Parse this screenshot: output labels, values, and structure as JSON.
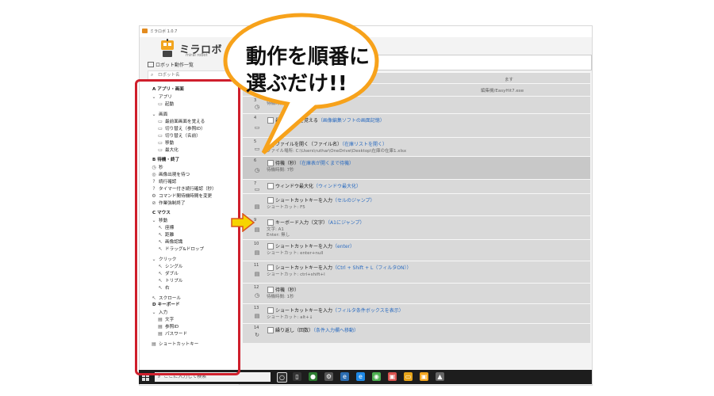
{
  "window": {
    "title": "ミラロボ 1.0.7"
  },
  "logo": {
    "brand": "ミラロボ",
    "subtitle": "mirai robot"
  },
  "toolbar": {
    "label": "ロボット動作一覧"
  },
  "search": {
    "placeholder": "ロボット名"
  },
  "sidebar": {
    "items": [
      {
        "text": "A  アプリ・画面",
        "indent": 0,
        "icon": "",
        "icon_name": "expand-chevron-icon"
      },
      {
        "text": "アプリ",
        "indent": 1,
        "icon": "⌄",
        "icon_name": "expand-chevron-icon"
      },
      {
        "text": "起動",
        "indent": 2,
        "icon": "▭",
        "icon_name": "window-icon"
      },
      {
        "text": "画面",
        "indent": 1,
        "icon": "⌄",
        "icon_name": "expand-chevron-icon"
      },
      {
        "text": "最前面画面を覚える",
        "indent": 2,
        "icon": "▭",
        "icon_name": "window-icon"
      },
      {
        "text": "切り替え（参照ID）",
        "indent": 2,
        "icon": "▭",
        "icon_name": "window-icon"
      },
      {
        "text": "切り替え（名前）",
        "indent": 2,
        "icon": "▭",
        "icon_name": "window-icon"
      },
      {
        "text": "移動",
        "indent": 2,
        "icon": "▭",
        "icon_name": "window-icon"
      },
      {
        "text": "最大化",
        "indent": 2,
        "icon": "▭",
        "icon_name": "window-icon"
      },
      {
        "text": "B  待機・終了",
        "indent": 0,
        "icon": "",
        "icon_name": "expand-chevron-icon"
      },
      {
        "text": "秒",
        "indent": 1,
        "icon": "◷",
        "icon_name": "clock-icon"
      },
      {
        "text": "画像出現を待つ",
        "indent": 1,
        "icon": "◎",
        "icon_name": "image-wait-icon"
      },
      {
        "text": "続行確認",
        "indent": 1,
        "icon": "?",
        "icon_name": "question-icon"
      },
      {
        "text": "タイマー付き続行確認（秒）",
        "indent": 1,
        "icon": "?",
        "icon_name": "question-icon"
      },
      {
        "text": "コマンド間待機時間を変更",
        "indent": 1,
        "icon": "⚙",
        "icon_name": "gear-icon"
      },
      {
        "text": "作業強制終了",
        "indent": 1,
        "icon": "⊘",
        "icon_name": "stop-icon"
      },
      {
        "text": "C  マウス",
        "indent": 0,
        "icon": "",
        "icon_name": "expand-chevron-icon"
      },
      {
        "text": "移動",
        "indent": 1,
        "icon": "⌄",
        "icon_name": "expand-chevron-icon"
      },
      {
        "text": "座標",
        "indent": 2,
        "icon": "↖",
        "icon_name": "cursor-icon"
      },
      {
        "text": "距離",
        "indent": 2,
        "icon": "↖",
        "icon_name": "cursor-icon"
      },
      {
        "text": "画像認識",
        "indent": 2,
        "icon": "↖",
        "icon_name": "cursor-icon"
      },
      {
        "text": "ドラッグ&ドロップ",
        "indent": 2,
        "icon": "↖",
        "icon_name": "cursor-icon"
      },
      {
        "text": "クリック",
        "indent": 1,
        "icon": "⌄",
        "icon_name": "expand-chevron-icon"
      },
      {
        "text": "シングル",
        "indent": 2,
        "icon": "↖",
        "icon_name": "cursor-icon"
      },
      {
        "text": "ダブル",
        "indent": 2,
        "icon": "↖",
        "icon_name": "cursor-icon"
      },
      {
        "text": "トリプル",
        "indent": 2,
        "icon": "↖",
        "icon_name": "cursor-icon"
      },
      {
        "text": "右",
        "indent": 2,
        "icon": "↖",
        "icon_name": "cursor-icon"
      },
      {
        "text": "スクロール",
        "indent": 1,
        "icon": "↖",
        "icon_name": "cursor-icon"
      },
      {
        "text": "D  キーボード",
        "indent": 0,
        "icon": "",
        "icon_name": "expand-chevron-icon"
      },
      {
        "text": "入力",
        "indent": 1,
        "icon": "⌄",
        "icon_name": "expand-chevron-icon"
      },
      {
        "text": "文字",
        "indent": 2,
        "icon": "▤",
        "icon_name": "keyboard-icon"
      },
      {
        "text": "参照ID",
        "indent": 2,
        "icon": "▤",
        "icon_name": "keyboard-icon"
      },
      {
        "text": "パスワード",
        "indent": 2,
        "icon": "▤",
        "icon_name": "keyboard-icon"
      },
      {
        "text": "ショートカットキー",
        "indent": 1,
        "icon": "▤",
        "icon_name": "keyboard-icon"
      }
    ]
  },
  "steps": [
    {
      "num": "",
      "icon": "",
      "title": "",
      "note": "",
      "details": [
        "ます"
      ]
    },
    {
      "num": "",
      "icon": "",
      "title": "",
      "note": "",
      "details": [
        "編集機/EasyHit7.exe"
      ]
    },
    {
      "num": "3",
      "icon": "◷",
      "icon_name": "clock-icon",
      "title": "",
      "note": "",
      "details": [
        "待機時間"
      ]
    },
    {
      "num": "4",
      "icon": "▭",
      "icon_name": "window-icon",
      "title": "最前面画面を覚える",
      "note": "（画像編集ソフトの画面記憶）",
      "details": []
    },
    {
      "num": "5",
      "icon": "▭",
      "icon_name": "file-icon",
      "title": "ファイルを開く（ファイル名）",
      "note": "（在庫リストを開く）",
      "details": [
        "ファイル場所: C:\\Users\\ruthar\\OneDrive\\Desktop\\在庫の在庫1.xlsx"
      ]
    },
    {
      "num": "6",
      "icon": "◷",
      "icon_name": "clock-icon",
      "title": "待機（秒）",
      "note": "（在庫表が開くまで待機）",
      "details": [
        "待機時間: 7秒"
      ]
    },
    {
      "num": "7",
      "icon": "▭",
      "icon_name": "window-icon",
      "title": "ウィンドウ最大化",
      "note": "（ウィンドウ最大化）",
      "details": []
    },
    {
      "num": "",
      "icon": "▤",
      "icon_name": "keyboard-icon",
      "title": "ショートカットキーを入力",
      "note": "（セルのジャンプ）",
      "details": [
        "ショートカット: F5"
      ]
    },
    {
      "num": "9",
      "icon": "▤",
      "icon_name": "keyboard-icon",
      "title": "キーボード入力（文字）",
      "note": "（A1にジャンプ）",
      "details": [
        "文字: A1",
        "Enter: 無し"
      ]
    },
    {
      "num": "10",
      "icon": "▤",
      "icon_name": "keyboard-icon",
      "title": "ショートカットキーを入力",
      "note": "（enter）",
      "details": [
        "ショートカット: enter+null"
      ]
    },
    {
      "num": "11",
      "icon": "▤",
      "icon_name": "keyboard-icon",
      "title": "ショートカットキーを入力",
      "note": "（Ctrl + Shift + L（フィルタON））",
      "details": [
        "ショートカット: ctrl+shift+l"
      ]
    },
    {
      "num": "12",
      "icon": "◷",
      "icon_name": "clock-icon",
      "title": "待機（秒）",
      "note": "",
      "details": [
        "待機時間: 1秒"
      ]
    },
    {
      "num": "13",
      "icon": "▤",
      "icon_name": "keyboard-icon",
      "title": "ショートカットキーを入力",
      "note": "（フィルタ条件ボックスを表示）",
      "details": [
        "ショートカット: alt+↓"
      ]
    },
    {
      "num": "14",
      "icon": "↻",
      "icon_name": "loop-icon",
      "title": "繰り返し（回数）",
      "note": "（条件入力欄へ移動）",
      "details": []
    }
  ],
  "callout": {
    "line1": "動作を順番に",
    "line2": "選ぶだけ!!"
  },
  "taskbar": {
    "search_placeholder": "ここに入力して検索"
  },
  "colors": {
    "frame": "#cf1f2c",
    "bubble": "#f7a21b",
    "arrow": "#f6d400",
    "note": "#2a6bc0"
  }
}
